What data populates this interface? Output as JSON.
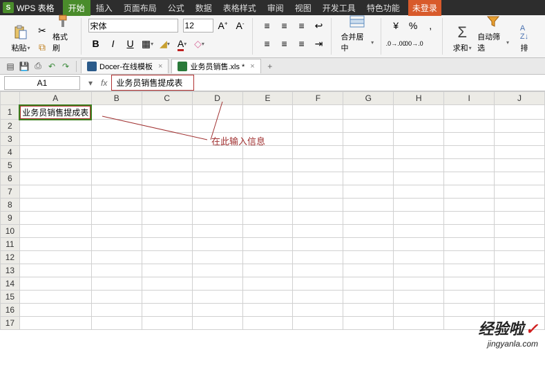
{
  "app": {
    "logo_letter": "S",
    "name": "WPS 表格"
  },
  "menu": {
    "items": [
      "开始",
      "插入",
      "页面布局",
      "公式",
      "数据",
      "表格样式",
      "审阅",
      "视图",
      "开发工具",
      "特色功能"
    ],
    "active_index": 0,
    "login": "未登录"
  },
  "ribbon": {
    "paste": "粘贴",
    "format_painter": "格式刷",
    "font_name": "宋体",
    "font_size": "12",
    "bold": "B",
    "italic": "I",
    "underline": "U",
    "merge_center": "合并居中",
    "sum": "求和",
    "autofilter": "自动筛选",
    "sort": "排"
  },
  "qat": {
    "tabs": [
      {
        "icon": "docer",
        "label": "Docer-在线模板",
        "active": false
      },
      {
        "icon": "xls",
        "label": "业务员销售.xls *",
        "active": true
      }
    ]
  },
  "formula_bar": {
    "cell_ref": "A1",
    "fx": "fx",
    "value": "业务员销售提成表"
  },
  "grid": {
    "columns": [
      "A",
      "B",
      "C",
      "D",
      "E",
      "F",
      "G",
      "H",
      "I",
      "J"
    ],
    "rows": 17,
    "selected_cell": "A1",
    "cells": {
      "A1": "业务员销售提成表"
    }
  },
  "annotation": {
    "text": "在此输入信息"
  },
  "watermark": {
    "big": "经验啦",
    "check": "✓",
    "small": "jingyanla.com"
  }
}
